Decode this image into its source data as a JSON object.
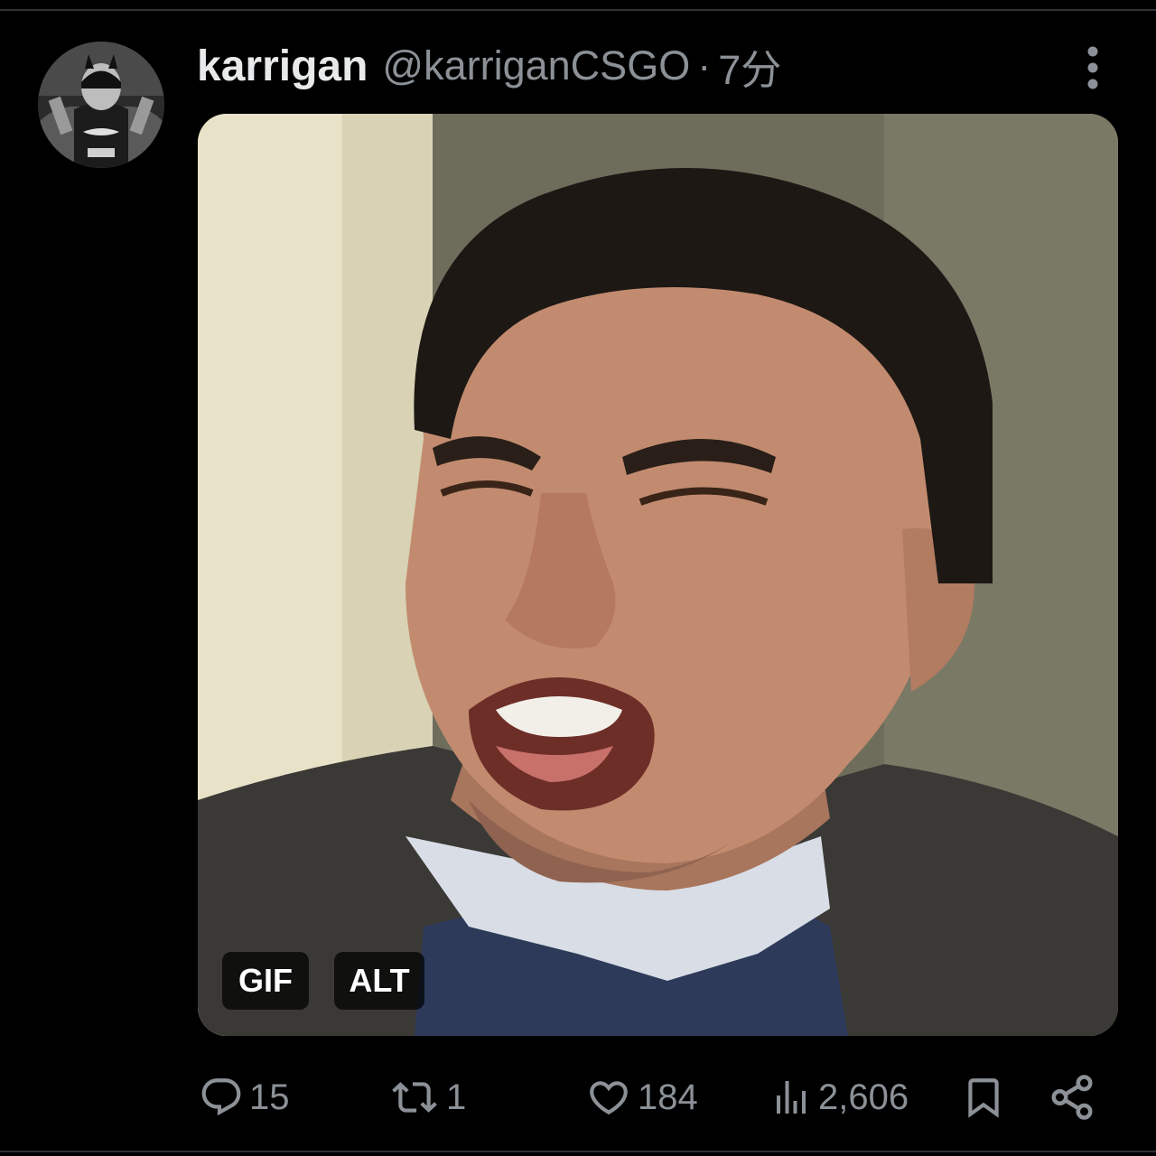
{
  "tweet": {
    "author_name": "karrigan",
    "handle": "@karriganCSGO",
    "separator": "·",
    "time_ago": "7分",
    "media": {
      "gif_badge": "GIF",
      "alt_badge": "ALT"
    },
    "stats": {
      "replies": "15",
      "retweets": "1",
      "likes": "184",
      "views": "2,606"
    }
  },
  "icons": {
    "reply": "reply-icon",
    "retweet": "retweet-icon",
    "like": "heart-icon",
    "views": "views-icon",
    "bookmark": "bookmark-icon",
    "share": "share-icon",
    "more": "more-vertical-icon"
  },
  "colors": {
    "background": "#000000",
    "text_primary": "#e7e9ea",
    "text_secondary": "#8b9197",
    "divider": "#2f3336"
  }
}
